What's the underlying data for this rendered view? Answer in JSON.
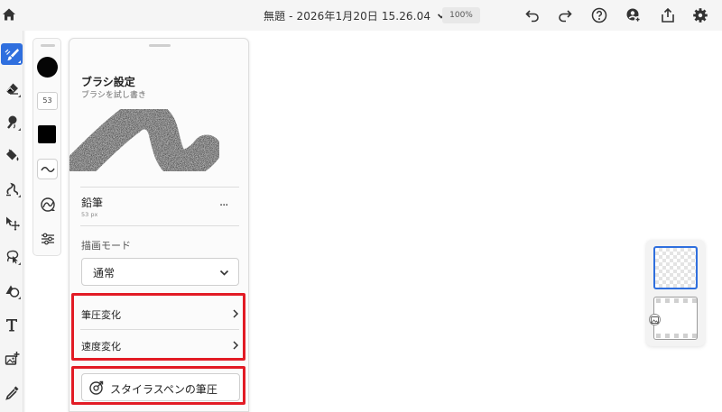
{
  "topbar": {
    "document_title": "無題 - 2026年1月20日 15.26.04",
    "zoom": "100%",
    "icons": [
      "home-icon",
      "chevron-down-icon",
      "undo-icon",
      "redo-icon",
      "help-icon",
      "invite-icon",
      "share-icon",
      "settings-icon"
    ]
  },
  "toolbar": {
    "tools": [
      "brush",
      "eraser",
      "smudge",
      "fill",
      "liquify",
      "move",
      "lasso-select",
      "shape",
      "text",
      "image",
      "eyedropper"
    ],
    "active_tool": "brush"
  },
  "brush_mini": {
    "size_value": "53",
    "color": "#000000"
  },
  "brush_panel": {
    "title": "ブラシ設定",
    "subtitle": "ブラシを試し書き",
    "brush_name": "鉛筆",
    "brush_size": "53 px",
    "more": "...",
    "draw_mode_label": "描画モード",
    "draw_mode_value": "通常",
    "pressure_label": "筆圧変化",
    "speed_label": "速度変化",
    "stylus_button_label": "スタイラスペンの筆圧"
  },
  "colors": {
    "accent": "#2f6fde",
    "highlight": "#e21b25"
  }
}
